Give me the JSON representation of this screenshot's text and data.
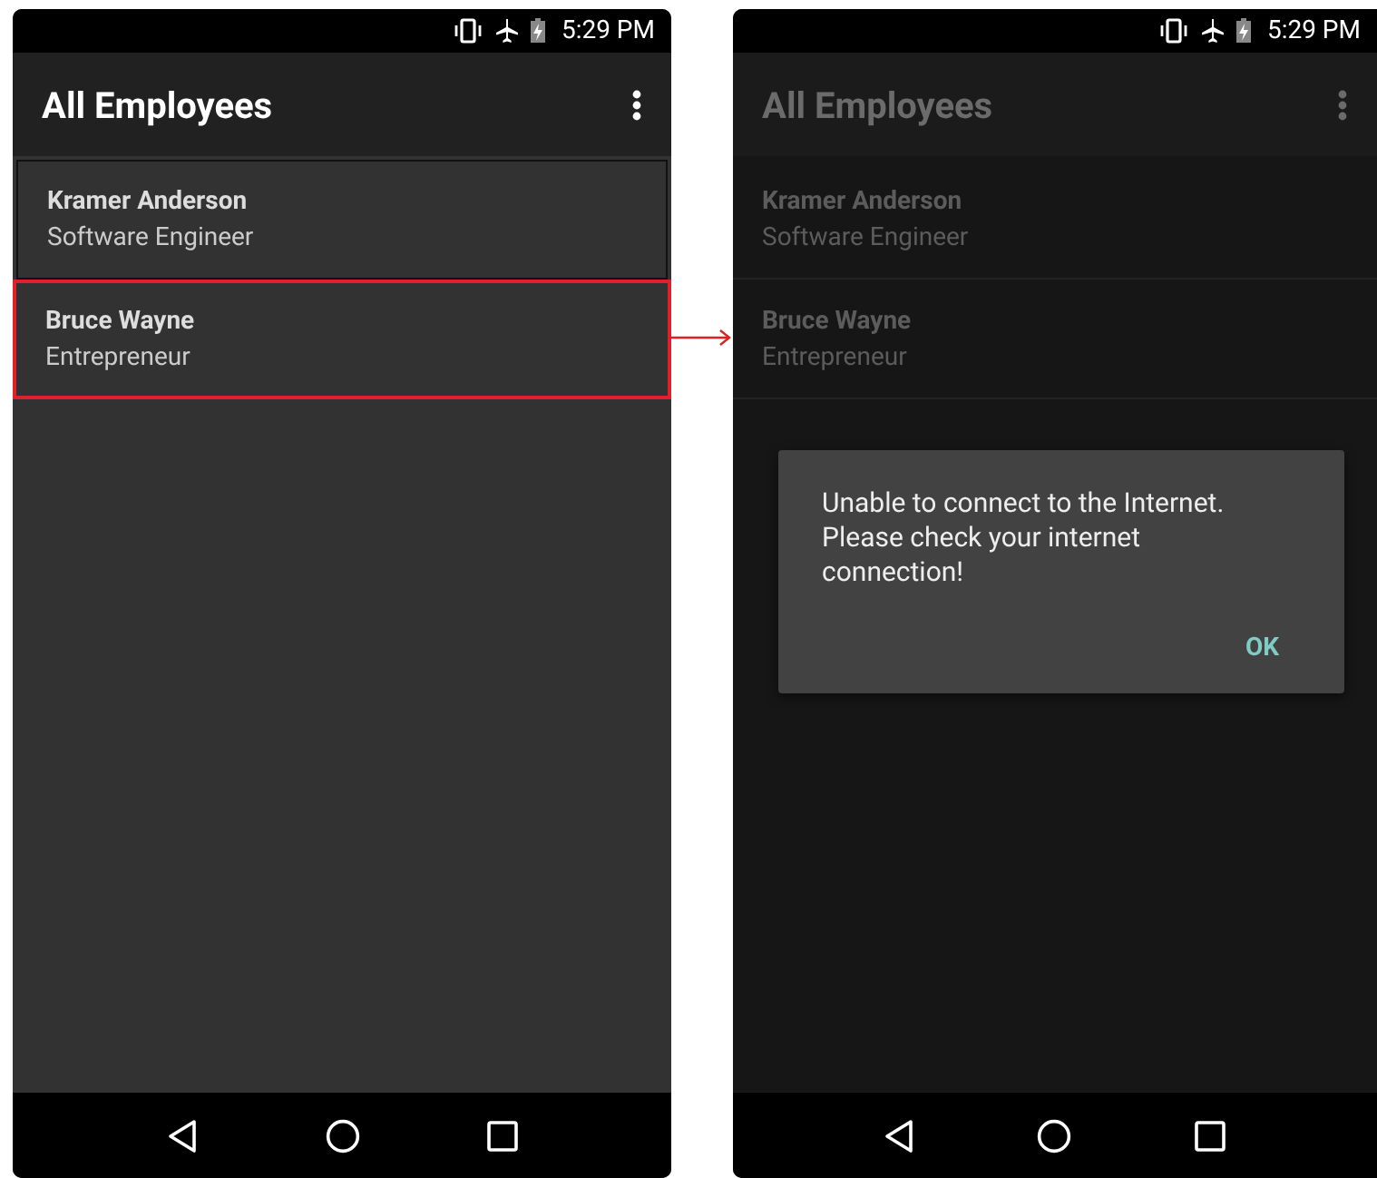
{
  "screens": [
    {
      "status_time": "5:29 PM",
      "title": "All Employees",
      "dimmed": false,
      "employees": [
        {
          "name": "Kramer Anderson",
          "role": "Software Engineer",
          "selected": false
        },
        {
          "name": "Bruce Wayne",
          "role": "Entrepreneur",
          "selected": true
        }
      ]
    },
    {
      "status_time": "5:29 PM",
      "title": "All Employees",
      "dimmed": true,
      "employees": [
        {
          "name": "Kramer Anderson",
          "role": "Software Engineer",
          "selected": false
        },
        {
          "name": "Bruce Wayne",
          "role": "Entrepreneur",
          "selected": false
        }
      ],
      "dialog": {
        "message": "Unable to connect to the Internet. Please check your internet connection!",
        "button": "OK"
      }
    }
  ]
}
